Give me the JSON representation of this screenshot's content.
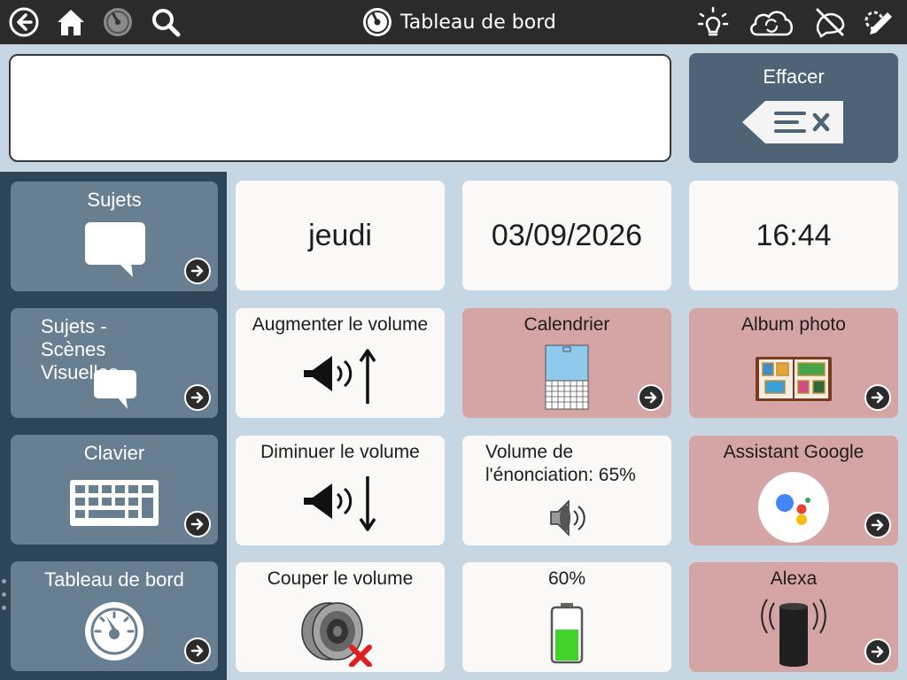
{
  "topbar": {
    "title": "Tableau de bord",
    "icons": [
      "back-icon",
      "home-icon",
      "dashboard-icon",
      "search-icon",
      "lightbulb-icon",
      "sync-cloud-icon",
      "hide-icon",
      "edit-icon"
    ]
  },
  "message": {
    "value": ""
  },
  "clear_button": {
    "label": "Effacer"
  },
  "sidebar": {
    "items": [
      {
        "label": "Sujets",
        "icon": "speech-bubble-icon"
      },
      {
        "label": "Sujets - Scènes Visuelles",
        "icon": "speech-bubble-icon"
      },
      {
        "label": "Clavier",
        "icon": "keyboard-icon"
      },
      {
        "label": "Tableau de bord",
        "icon": "dashboard-gauge-icon"
      }
    ]
  },
  "grid": {
    "day": "jeudi",
    "date": "03/09/2026",
    "time": "16:44",
    "volume_up": "Augmenter le volume",
    "calendar": "Calendrier",
    "photo_album": "Album photo",
    "volume_down": "Diminuer le volume",
    "speech_volume": "Volume de l'énonciation: 65%",
    "google_assistant": "Assistant Google",
    "mute": "Couper le volume",
    "battery": "60%",
    "battery_level": 0.6,
    "alexa": "Alexa"
  },
  "colors": {
    "topbar": "#2b2b2b",
    "sidebar": "#2e4557",
    "sidebar_tile": "#687f92",
    "pink_tile": "#d5a4a4",
    "clear_button": "#4e6376"
  }
}
